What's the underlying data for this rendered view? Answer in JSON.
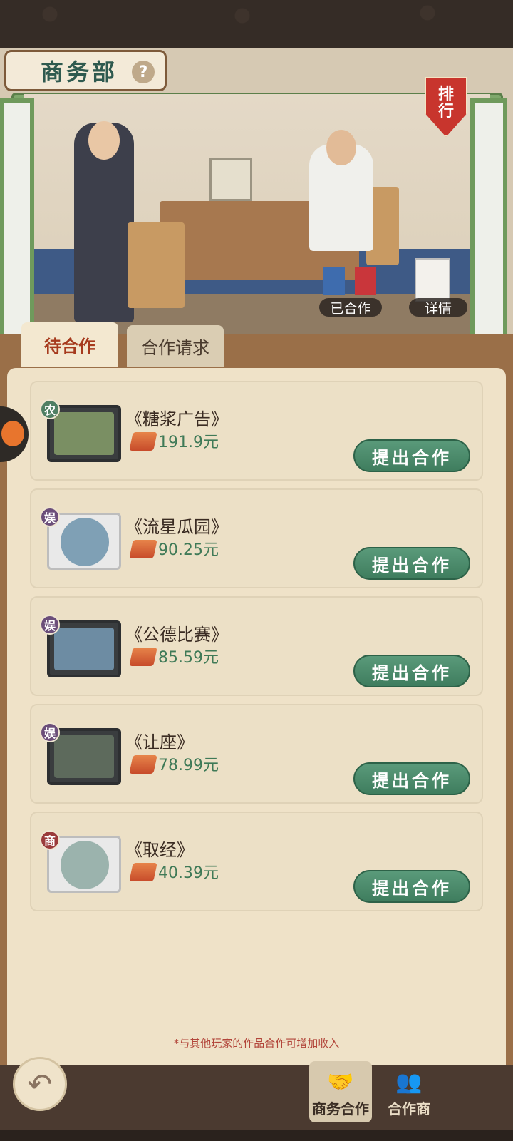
{
  "header": {
    "title": "商务部",
    "help_icon": "?",
    "rank_banner": [
      "排",
      "行"
    ],
    "partnered_button": "已合作",
    "details_button": "详情"
  },
  "tabs": {
    "pending": "待合作",
    "requests": "合作请求"
  },
  "cards": [
    {
      "badge": "农",
      "badge_color": "#4f7f63",
      "title": "《糖浆广告》",
      "price": "191.9元",
      "button": "提出合作",
      "thumb": "tv"
    },
    {
      "badge": "娱",
      "badge_color": "#6b4e7a",
      "title": "《流星瓜园》",
      "price": "90.25元",
      "button": "提出合作",
      "thumb": "disc"
    },
    {
      "badge": "娱",
      "badge_color": "#6b4e7a",
      "title": "《公德比赛》",
      "price": "85.59元",
      "button": "提出合作",
      "thumb": "tv"
    },
    {
      "badge": "娱",
      "badge_color": "#6b4e7a",
      "title": "《让座》",
      "price": "78.99元",
      "button": "提出合作",
      "thumb": "tv"
    },
    {
      "badge": "商",
      "badge_color": "#9b3b3b",
      "title": "《取经》",
      "price": "40.39元",
      "button": "提出合作",
      "thumb": "disc"
    }
  ],
  "note": "*与其他玩家的作品合作可增加收入",
  "bottom_nav": {
    "business": "商务合作",
    "partners": "合作商"
  },
  "icons": {
    "back": "arrow-left-icon",
    "handshake": "handshake-icon",
    "partners": "partners-icon",
    "coin": "money-stack-icon"
  }
}
